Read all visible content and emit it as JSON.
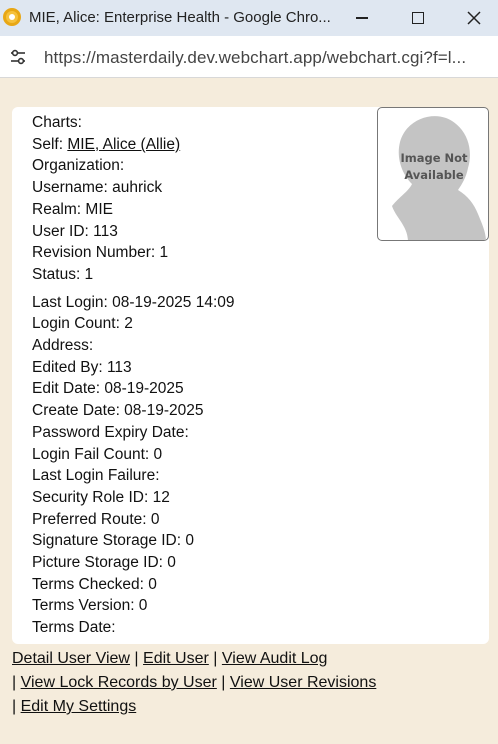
{
  "window": {
    "title": "MIE, Alice: Enterprise Health - Google Chro..."
  },
  "address_bar": {
    "url": "https://masterdaily.dev.webchart.app/webchart.cgi?f=l..."
  },
  "profile": {
    "fields_top": [
      {
        "label": "Charts:"
      },
      {
        "label": "Self: ",
        "link": "MIE, Alice (Allie)"
      },
      {
        "label": "Organization:"
      },
      {
        "label": "Username: auhrick"
      },
      {
        "label": "Realm: MIE"
      },
      {
        "label": "User ID: 113"
      },
      {
        "label": "Revision Number: 1"
      },
      {
        "label": "Status: 1"
      }
    ],
    "fields_bottom": [
      {
        "label": "Last Login: 08-19-2025 14:09"
      },
      {
        "label": "Login Count: 2"
      },
      {
        "label": "Address:"
      },
      {
        "label": "Edited By: 113"
      },
      {
        "label": "Edit Date: 08-19-2025"
      },
      {
        "label": "Create Date: 08-19-2025"
      },
      {
        "label": "Password Expiry Date:"
      },
      {
        "label": "Login Fail Count: 0"
      },
      {
        "label": "Last Login Failure:"
      },
      {
        "label": "Security Role ID: 12"
      },
      {
        "label": "Preferred Route: 0"
      },
      {
        "label": "Signature Storage ID: 0"
      },
      {
        "label": "Picture Storage ID: 0"
      },
      {
        "label": "Terms Checked: 0"
      },
      {
        "label": "Terms Version: 0"
      },
      {
        "label": "Terms Date:"
      }
    ],
    "photo_caption_line1": "Image Not",
    "photo_caption_line2": "Available"
  },
  "links": {
    "detail_user_view": "Detail User View",
    "edit_user": "Edit User",
    "view_audit_log": "View Audit Log",
    "view_lock_records": "View Lock Records by User",
    "view_user_revisions": "View User Revisions",
    "edit_my_settings": "Edit My Settings",
    "separator": "|"
  },
  "icons": {
    "app": "chrome-app-icon",
    "site_info": "tune-icon",
    "minimize": "minimize-icon",
    "maximize": "maximize-icon",
    "close": "close-icon"
  },
  "colors": {
    "page_background": "#f5ecdc",
    "titlebar_background": "#dfe7f1",
    "card_background": "#ffffff"
  }
}
